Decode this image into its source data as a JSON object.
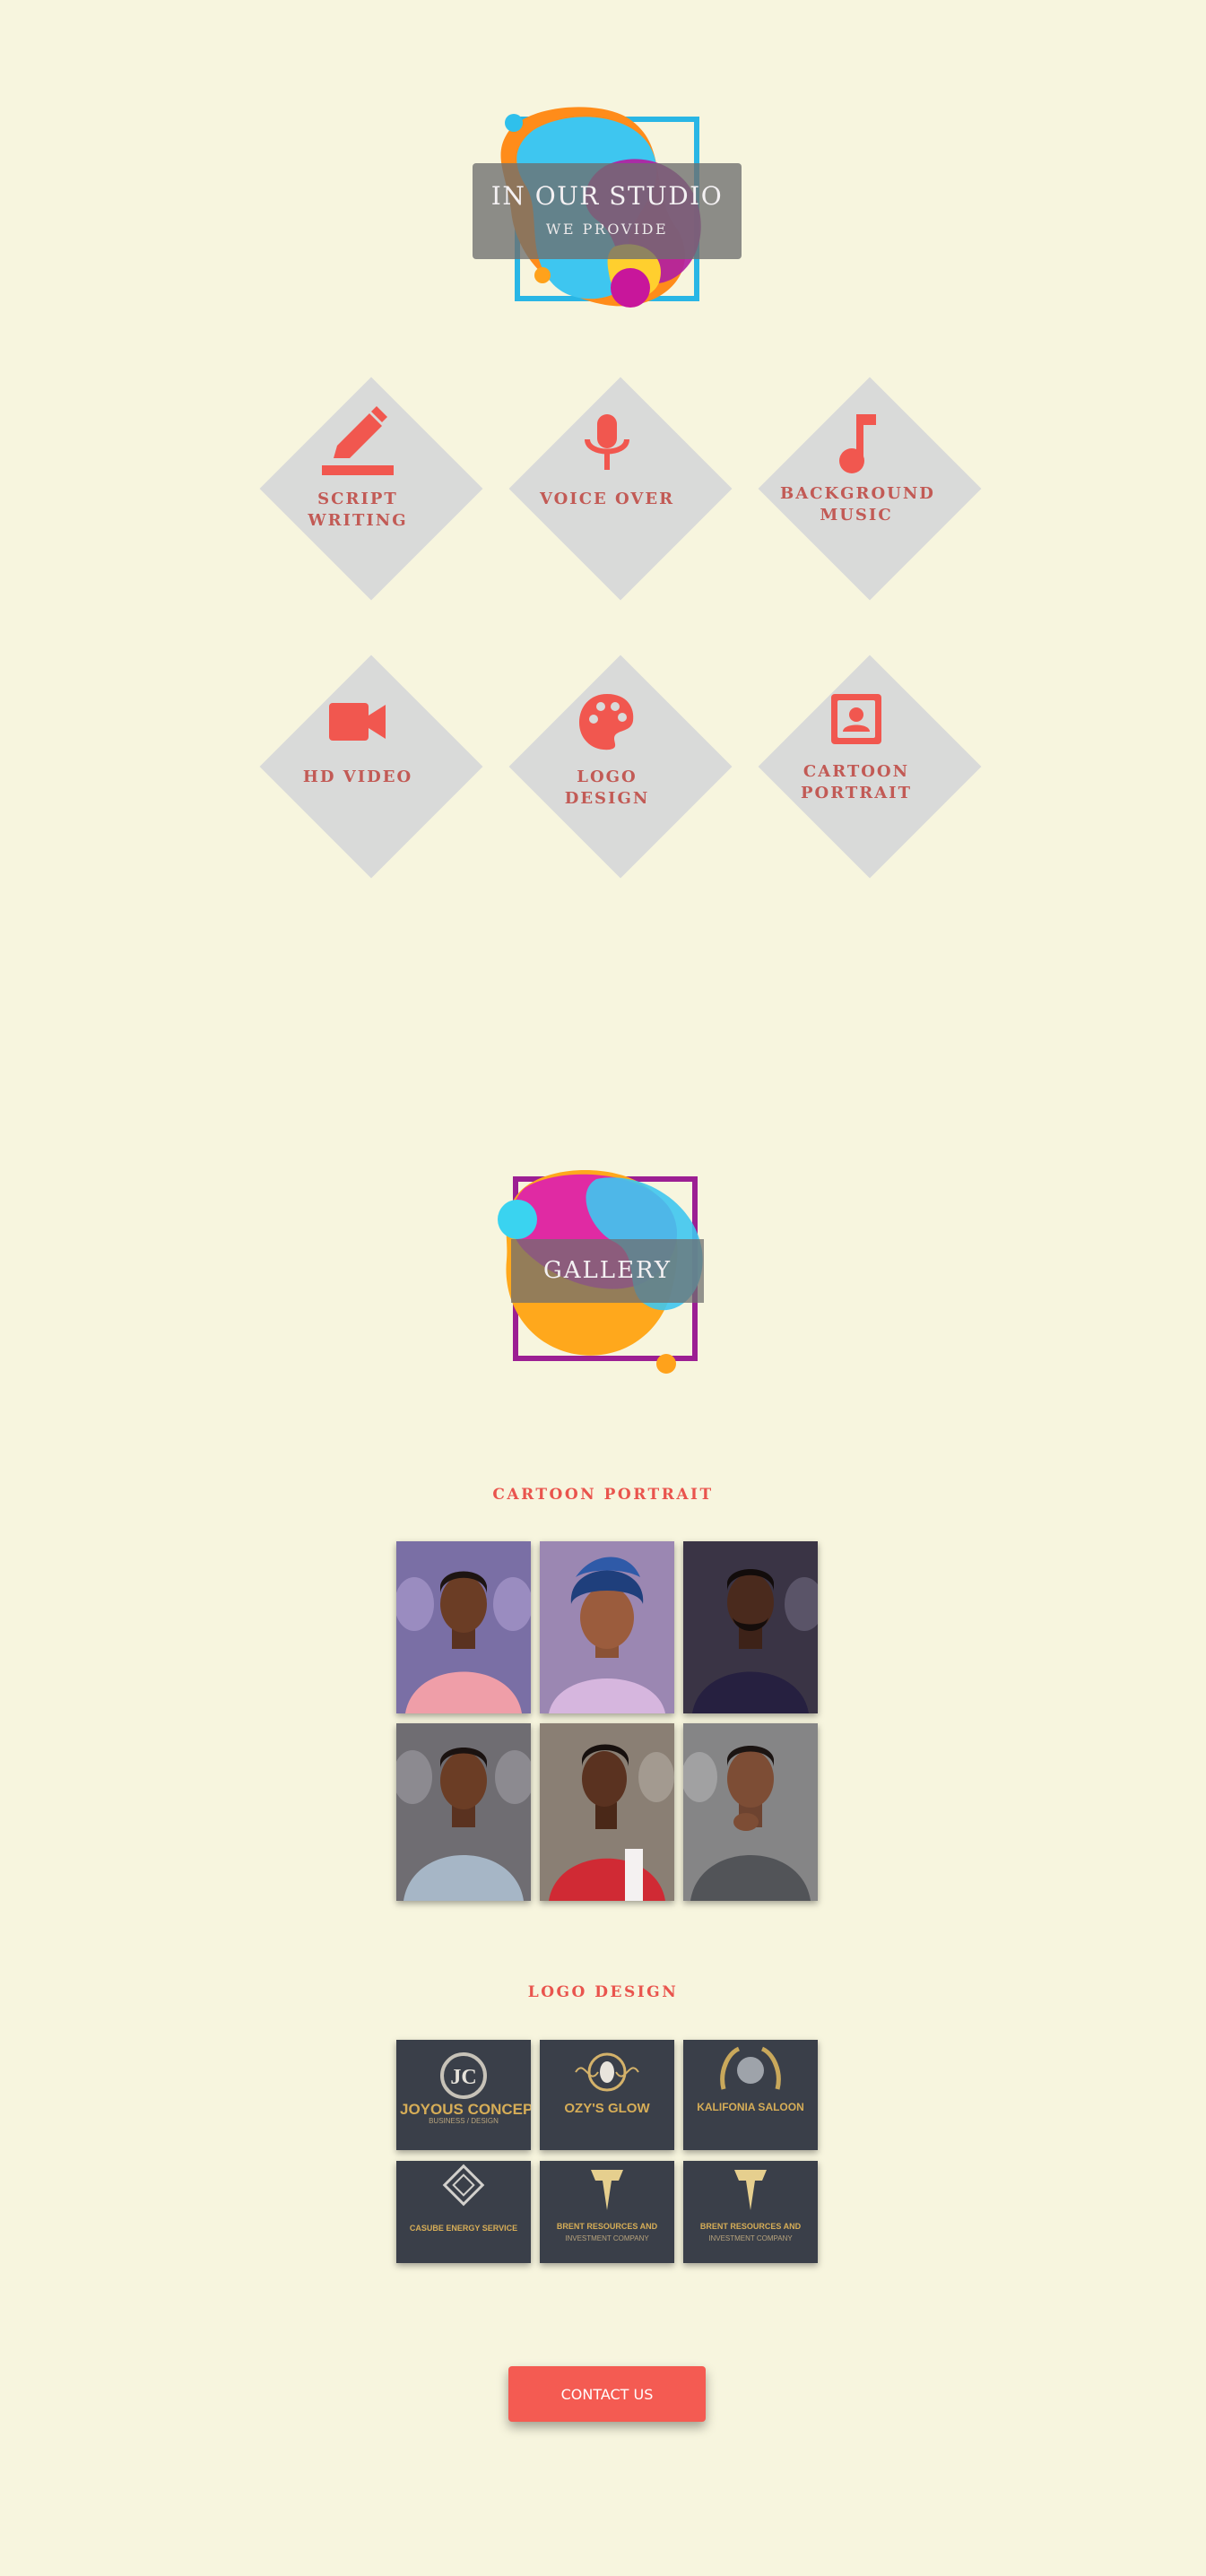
{
  "studio": {
    "title": "IN OUR STUDIO",
    "subtitle": "WE PROVIDE"
  },
  "services": [
    {
      "label": "SCRIPT WRITING",
      "icon": "pencil-icon"
    },
    {
      "label": "VOICE OVER",
      "icon": "microphone-icon"
    },
    {
      "label": "BACKGROUND MUSIC",
      "icon": "music-note-icon"
    },
    {
      "label": "HD VIDEO",
      "icon": "video-camera-icon"
    },
    {
      "label": "LOGO DESIGN",
      "icon": "palette-icon"
    },
    {
      "label": "CARTOON PORTRAIT",
      "icon": "portrait-icon"
    }
  ],
  "gallery": {
    "title": "GALLERY",
    "cartoon_heading": "CARTOON PORTRAIT",
    "logo_heading": "LOGO DESIGN",
    "logos": [
      {
        "line1": "JOYOUS CONCEPT",
        "line2": "BUSINESS / DESIGN"
      },
      {
        "line1": "OZY'S GLOW",
        "line2": ""
      },
      {
        "line1": "KALIFONIA SALOON",
        "line2": ""
      },
      {
        "line1": "CASUBE ENERGY SERVICE",
        "line2": ""
      },
      {
        "line1": "BRENT RESOURCES AND",
        "line2": "INVESTMENT COMPANY"
      },
      {
        "line1": "BRENT RESOURCES AND",
        "line2": "INVESTMENT COMPANY"
      }
    ]
  },
  "contact": {
    "label": "CONTACT US"
  },
  "colors": {
    "background": "#f7f5de",
    "accent": "#f45b52",
    "service_label": "#c25a55",
    "diamond": "#d9dad9"
  }
}
